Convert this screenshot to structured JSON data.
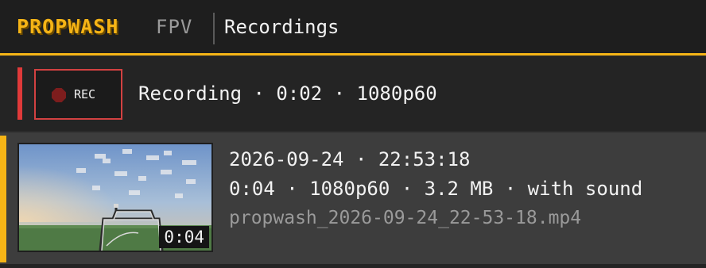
{
  "header": {
    "brand": "PROPWASH",
    "brand_sub": "FPV",
    "title": "Recordings"
  },
  "recording": {
    "button_label": "REC",
    "status": "Recording · 0:02 · 1080p60"
  },
  "recordings": [
    {
      "date": "2026-09-24 · 22:53:18",
      "meta": "0:04 · 1080p60 · 3.2 MB · with sound",
      "filename": "propwash_2026-09-24_22-53-18.mp4",
      "duration": "0:04"
    }
  ],
  "colors": {
    "accent": "#f5b416",
    "record": "#e03a3a",
    "muted_text": "#9a9a9a"
  },
  "icons": {
    "record": "record-dot-icon"
  }
}
